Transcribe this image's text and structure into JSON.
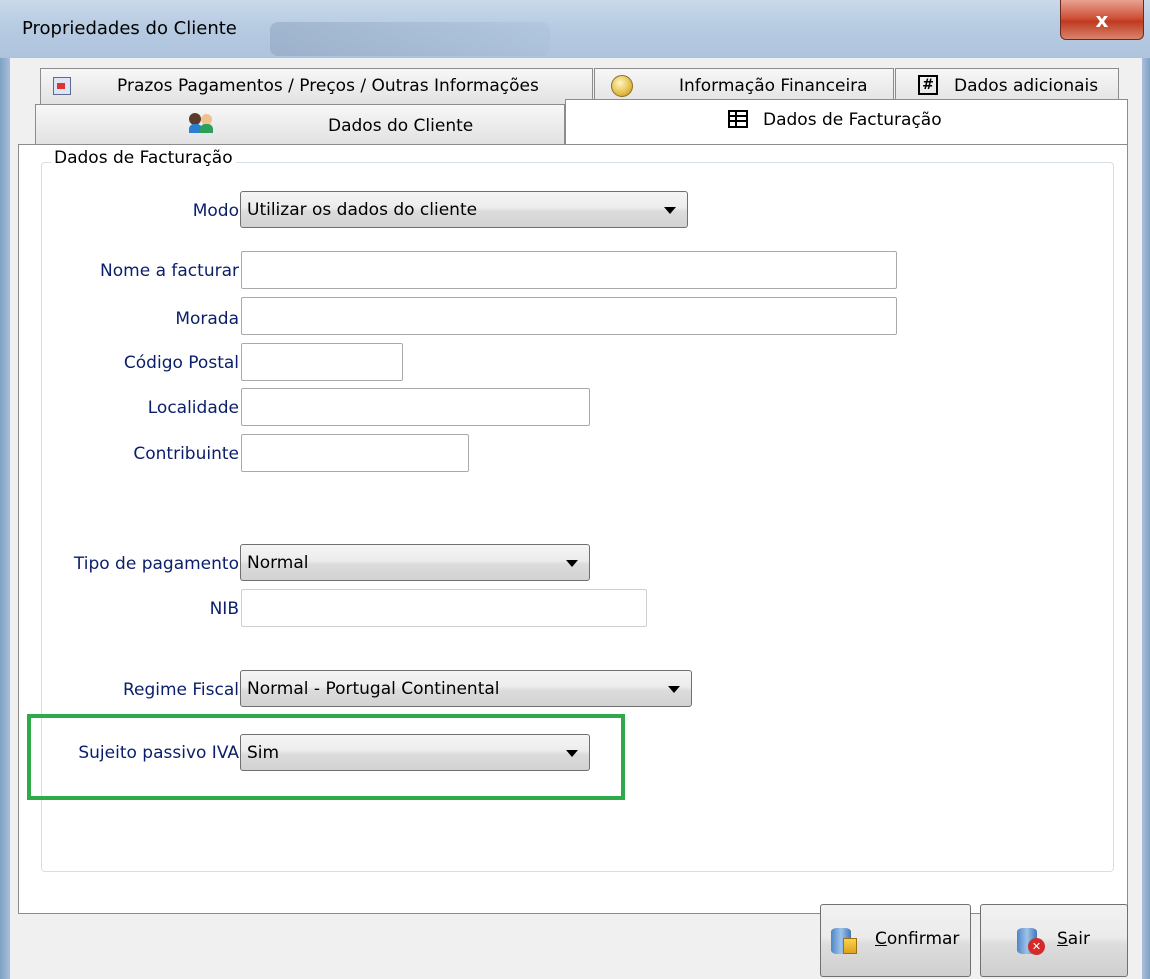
{
  "window": {
    "title": "Propriedades do Cliente",
    "close_glyph": "x"
  },
  "tabs_row1": [
    {
      "label": "Prazos Pagamentos / Preços / Outras Informações",
      "icon": "calendar-icon"
    },
    {
      "label": "Informação Financeira",
      "icon": "clock-icon"
    },
    {
      "label": "Dados adicionais",
      "icon": "hash-icon"
    }
  ],
  "tabs_row2": [
    {
      "label": "Dados do Cliente",
      "icon": "users-icon"
    },
    {
      "label": "Dados de Facturação",
      "icon": "table-icon",
      "active": true
    }
  ],
  "group": {
    "title": "Dados de Facturação"
  },
  "fields": {
    "modo": {
      "label": "Modo",
      "value": "Utilizar os dados do cliente"
    },
    "nome": {
      "label": "Nome a facturar",
      "value": ""
    },
    "morada": {
      "label": "Morada",
      "value": ""
    },
    "codigo_postal": {
      "label": "Código Postal",
      "value": ""
    },
    "localidade": {
      "label": "Localidade",
      "value": ""
    },
    "contribuinte": {
      "label": "Contribuinte",
      "value": ""
    },
    "tipo_pagamento": {
      "label": "Tipo de pagamento",
      "value": "Normal"
    },
    "nib": {
      "label": "NIB",
      "value": ""
    },
    "regime_fiscal": {
      "label": "Regime Fiscal",
      "value": "Normal - Portugal Continental"
    },
    "sujeito_passivo": {
      "label": "Sujeito passivo IVA",
      "value": "Sim"
    }
  },
  "buttons": {
    "confirm": {
      "accel": "C",
      "rest": "onfirmar"
    },
    "exit": {
      "accel": "S",
      "rest": "air"
    }
  },
  "colors": {
    "label_text": "#0a1e6a",
    "highlight_border": "#2faa4a"
  }
}
